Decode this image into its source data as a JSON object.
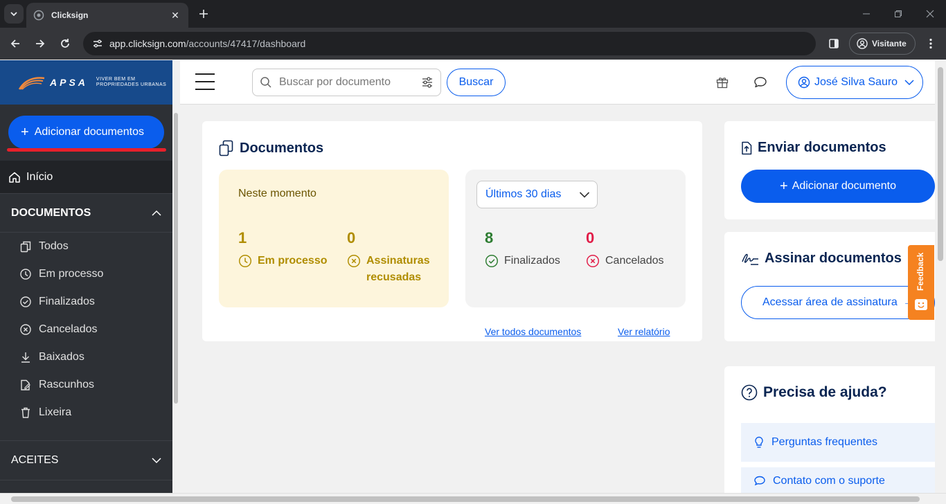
{
  "browser": {
    "tab_title": "Clicksign",
    "url_host": "app.clicksign.com",
    "url_path": "/accounts/47417/dashboard",
    "profile_label": "Visitante"
  },
  "brand": {
    "logo_word": "APSA",
    "tagline_line1": "VIVER BEM EM",
    "tagline_line2": "PROPRIEDADES URBANAS"
  },
  "sidebar": {
    "add_button": "Adicionar documentos",
    "home": "Início",
    "documents_section": "DOCUMENTOS",
    "items": [
      {
        "label": "Todos",
        "icon": "copy-icon"
      },
      {
        "label": "Em processo",
        "icon": "clock-icon"
      },
      {
        "label": "Finalizados",
        "icon": "check-circle-icon"
      },
      {
        "label": "Cancelados",
        "icon": "x-circle-icon"
      },
      {
        "label": "Baixados",
        "icon": "download-icon"
      },
      {
        "label": "Rascunhos",
        "icon": "draft-icon"
      },
      {
        "label": "Lixeira",
        "icon": "trash-icon"
      }
    ],
    "accepts_section": "ACEITES"
  },
  "header": {
    "search_placeholder": "Buscar por documento",
    "search_button": "Buscar",
    "user_name": "José Silva Sauro"
  },
  "documents_card": {
    "title": "Documentos",
    "now_label": "Neste momento",
    "in_process_count": "1",
    "in_process_label": "Em processo",
    "rejected_count": "0",
    "rejected_label_1": "Assinaturas",
    "rejected_label_2": "recusadas",
    "period": "Últimos 30 dias",
    "finished_count": "8",
    "finished_label": "Finalizados",
    "canceled_count": "0",
    "canceled_label": "Cancelados",
    "link_all": "Ver todos documentos",
    "link_report": "Ver relatório"
  },
  "send_card": {
    "title": "Enviar documentos",
    "button": "Adicionar documento"
  },
  "sign_card": {
    "title": "Assinar documentos",
    "button": "Acessar área de assinatura"
  },
  "help_card": {
    "title": "Precisa de ajuda?",
    "faq": "Perguntas frequentes",
    "support": "Contato com o suporte"
  },
  "feedback": {
    "label": "Feedback"
  },
  "colors": {
    "primary": "#0a5ded",
    "sidebar_bg": "#2d3035",
    "brand_blue": "#174a8b",
    "in_process": "#b08d00",
    "finished": "#2e7d32",
    "canceled": "#e11d48",
    "feedback": "#f58220"
  }
}
